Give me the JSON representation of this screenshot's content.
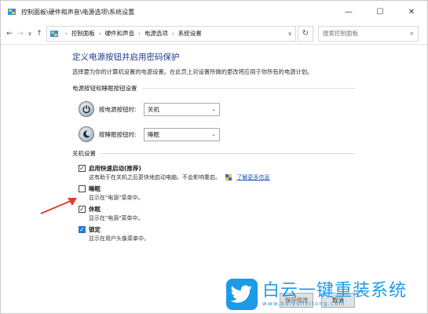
{
  "window": {
    "title": "控制面板\\硬件和声音\\电源选项\\系统设置",
    "minimize_glyph": "—",
    "maximize_glyph": "☐",
    "close_glyph": "✕"
  },
  "nav": {
    "back_glyph": "←",
    "forward_glyph": "→",
    "recent_glyph": "∨",
    "up_glyph": "↑",
    "dropdown_glyph": "∨",
    "refresh_glyph": "↻"
  },
  "breadcrumb": {
    "items": [
      "控制面板",
      "硬件和声音",
      "电源选项",
      "系统设置"
    ],
    "separator": "›"
  },
  "search": {
    "placeholder": "搜索控制面板",
    "icon": "⌕"
  },
  "page": {
    "title": "定义电源按钮并启用密码保护",
    "subtitle": "选择要为你的计算机设置的电源设置。在此页上对设置所做的更改将应用于你所有的电源计划。"
  },
  "power_section": {
    "heading": "电源按钮和睡眠按钮设置",
    "power_button": {
      "label": "按电源按钮时:",
      "value": "关机"
    },
    "sleep_button": {
      "label": "按睡眠按钮时:",
      "value": "睡眠"
    },
    "chevron": "⌄"
  },
  "shutdown_section": {
    "heading": "关机设置",
    "fast_startup": {
      "checked": true,
      "label": "启用快速启动(推荐)",
      "description": "这有助于在关机之后更快地启动电脑。不会影响重启。",
      "link": "了解更多信息"
    },
    "sleep": {
      "checked": false,
      "label": "睡眠",
      "description": "显示在\"电源\"菜单中。"
    },
    "hibernate": {
      "checked": true,
      "label": "休眠",
      "description": "显示在\"电源\"菜单中。"
    },
    "lock": {
      "checked": true,
      "label": "锁定",
      "description": "显示在用户头像菜单中。"
    },
    "check_glyph": "✓"
  },
  "footer": {
    "save_label": "保存修改",
    "cancel_label": "取消"
  },
  "watermark": {
    "name": "白云一键重装系统",
    "url": "www.baiyunxitong.com"
  },
  "colors": {
    "accent": "#1e3a8a",
    "link": "#1a56c8",
    "watermark": "#1c9be8",
    "arrow": "#e53935"
  }
}
